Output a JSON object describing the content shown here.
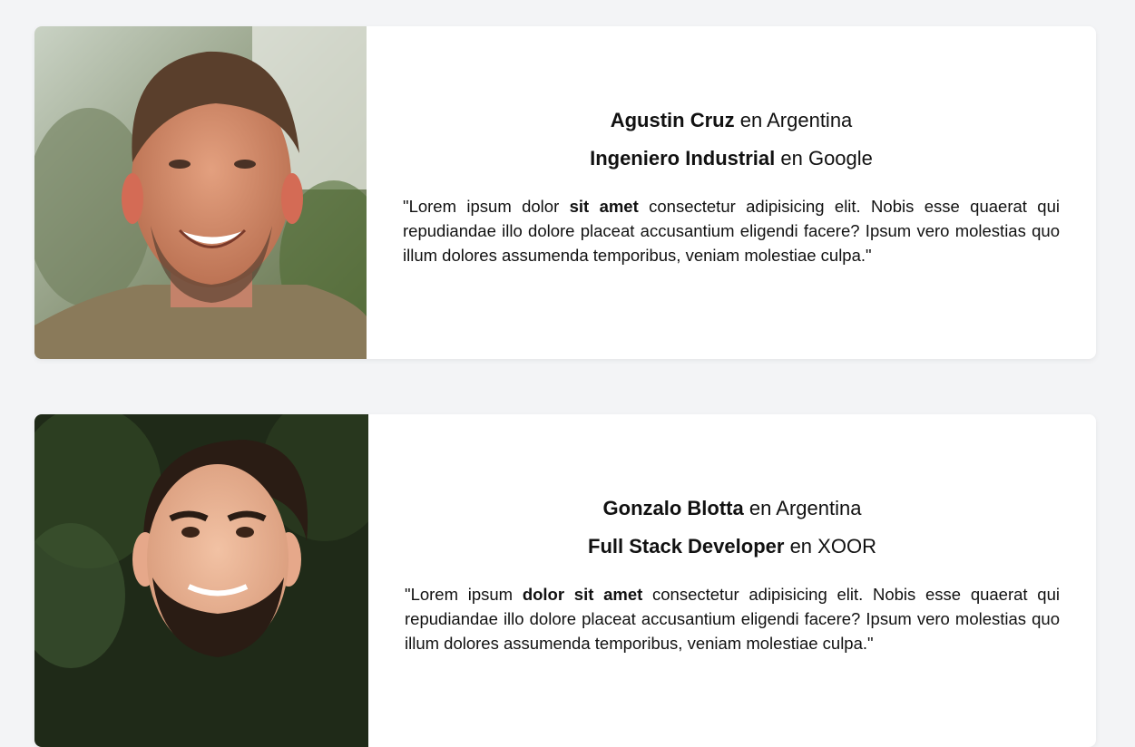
{
  "testimonials": [
    {
      "name": "Agustin Cruz",
      "location_prefix": "en",
      "location": "Argentina",
      "role": "Ingeniero Industrial",
      "company_prefix": "en",
      "company": "Google",
      "quote_start": "\"Lorem ipsum dolor ",
      "quote_bold": "sit amet",
      "quote_end": " consectetur adipisicing elit. Nobis esse quaerat qui repudiandae illo dolore placeat accusantium eligendi facere? Ipsum vero molestias quo illum dolores assumenda temporibus, veniam molestiae culpa.\""
    },
    {
      "name": "Gonzalo Blotta",
      "location_prefix": "en",
      "location": "Argentina",
      "role": "Full Stack Developer",
      "company_prefix": "en",
      "company": "XOOR",
      "quote_start": "\"Lorem ipsum ",
      "quote_bold": "dolor sit amet",
      "quote_end": " consectetur adipisicing elit. Nobis esse quaerat qui repudiandae illo dolore placeat accusantium eligendi facere? Ipsum vero molestias quo illum dolores assumenda temporibus, veniam molestiae culpa.\""
    }
  ],
  "colors": {
    "page_background": "#f3f4f6",
    "card_background": "#ffffff",
    "text": "#111111"
  }
}
